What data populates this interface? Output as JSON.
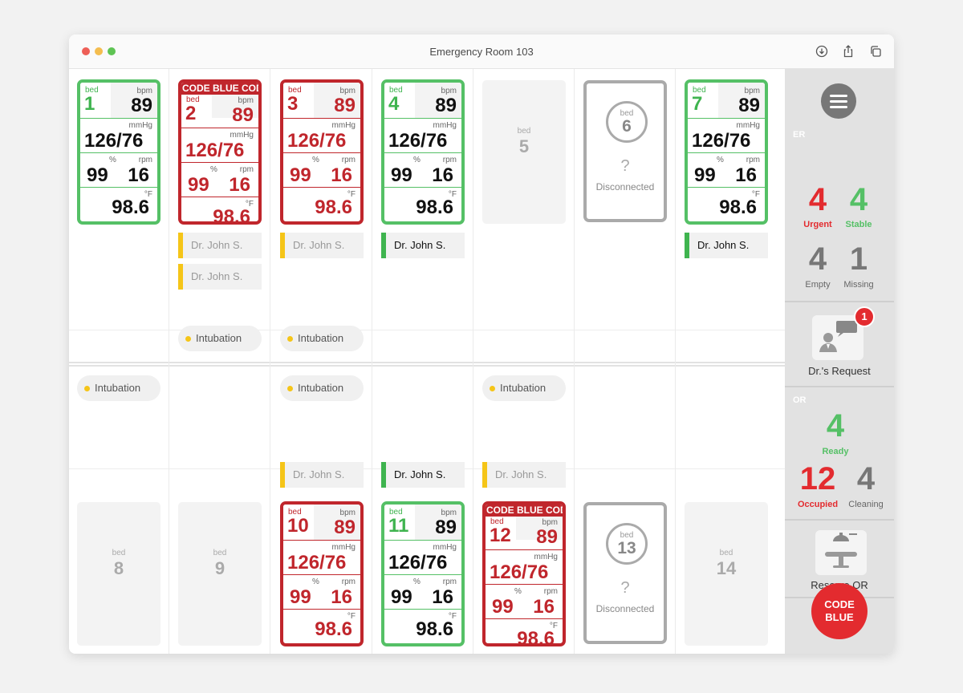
{
  "window": {
    "title": "Emergency Room 103"
  },
  "labels": {
    "bed": "bed",
    "bpm": "bpm",
    "mmHg": "mmHg",
    "pct": "%",
    "rpm": "rpm",
    "degF": "°F",
    "disconnected": "Disconnected",
    "unknown": "?"
  },
  "beds": [
    {
      "num": "1",
      "status": "stable",
      "hr": "89",
      "bp": "126/76",
      "spo2": "99",
      "resp": "16",
      "temp": "98.6",
      "code_blue": ""
    },
    {
      "num": "2",
      "status": "urgent",
      "hr": "89",
      "bp": "126/76",
      "spo2": "99",
      "resp": "16",
      "temp": "98.6",
      "code_blue": "CODE BLUE  CODE BLUE"
    },
    {
      "num": "3",
      "status": "urgent",
      "hr": "89",
      "bp": "126/76",
      "spo2": "99",
      "resp": "16",
      "temp": "98.6",
      "code_blue": ""
    },
    {
      "num": "4",
      "status": "stable",
      "hr": "89",
      "bp": "126/76",
      "spo2": "99",
      "resp": "16",
      "temp": "98.6",
      "code_blue": ""
    },
    {
      "num": "5",
      "status": "empty"
    },
    {
      "num": "6",
      "status": "disconnected"
    },
    {
      "num": "7",
      "status": "stable",
      "hr": "89",
      "bp": "126/76",
      "spo2": "99",
      "resp": "16",
      "temp": "98.6",
      "code_blue": ""
    },
    {
      "num": "8",
      "status": "empty"
    },
    {
      "num": "9",
      "status": "empty"
    },
    {
      "num": "10",
      "status": "urgent",
      "hr": "89",
      "bp": "126/76",
      "spo2": "99",
      "resp": "16",
      "temp": "98.6",
      "code_blue": ""
    },
    {
      "num": "11",
      "status": "stable",
      "hr": "89",
      "bp": "126/76",
      "spo2": "99",
      "resp": "16",
      "temp": "98.6",
      "code_blue": ""
    },
    {
      "num": "12",
      "status": "urgent",
      "hr": "89",
      "bp": "126/76",
      "spo2": "99",
      "resp": "16",
      "temp": "98.6",
      "code_blue": "CODE BLUE  CODE BLUE"
    },
    {
      "num": "13",
      "status": "disconnected"
    },
    {
      "num": "14",
      "status": "empty"
    }
  ],
  "doctors": [
    {
      "bed": "2",
      "name": "Dr. John S.",
      "state": "pending"
    },
    {
      "bed": "2",
      "name": "Dr. John S.",
      "state": "pending"
    },
    {
      "bed": "3",
      "name": "Dr. John S.",
      "state": "pending"
    },
    {
      "bed": "4",
      "name": "Dr. John S.",
      "state": "assigned"
    },
    {
      "bed": "7",
      "name": "Dr. John S.",
      "state": "assigned"
    },
    {
      "bed": "10",
      "name": "Dr. John S.",
      "state": "pending"
    },
    {
      "bed": "11",
      "name": "Dr. John S.",
      "state": "assigned"
    },
    {
      "bed": "12",
      "name": "Dr. John S.",
      "state": "pending"
    }
  ],
  "procedures": [
    {
      "bed": "2",
      "label": "Intubation"
    },
    {
      "bed": "3",
      "label": "Intubation"
    },
    {
      "bed": "8",
      "label": "Intubation"
    },
    {
      "bed": "10",
      "label": "Intubation"
    },
    {
      "bed": "12",
      "label": "Intubation"
    }
  ],
  "sidebar": {
    "er_label": "ER",
    "er": {
      "urgent": "4",
      "urgent_label": "Urgent",
      "stable": "4",
      "stable_label": "Stable",
      "empty": "4",
      "empty_label": "Empty",
      "missing": "1",
      "missing_label": "Missing"
    },
    "request_label": "Dr.'s Request",
    "request_count": "1",
    "or_label": "OR",
    "or": {
      "ready": "4",
      "ready_label": "Ready",
      "occupied": "12",
      "occupied_label": "Occupied",
      "cleaning": "4",
      "cleaning_label": "Cleaning"
    },
    "reserve_label": "Reserve OR",
    "code_blue_line1": "CODE",
    "code_blue_line2": "BLUE"
  },
  "colors": {
    "stable": "#55c066",
    "urgent": "#c0262c",
    "pending_bar": "#f5c518",
    "assigned_bar": "#3fb44f",
    "alert": "#e32b2f"
  },
  "icons": {
    "download": "download-icon",
    "share": "share-icon",
    "copy": "copy-icon",
    "menu": "menu-icon",
    "doctor": "doctor-request-icon",
    "or": "operating-table-icon"
  }
}
